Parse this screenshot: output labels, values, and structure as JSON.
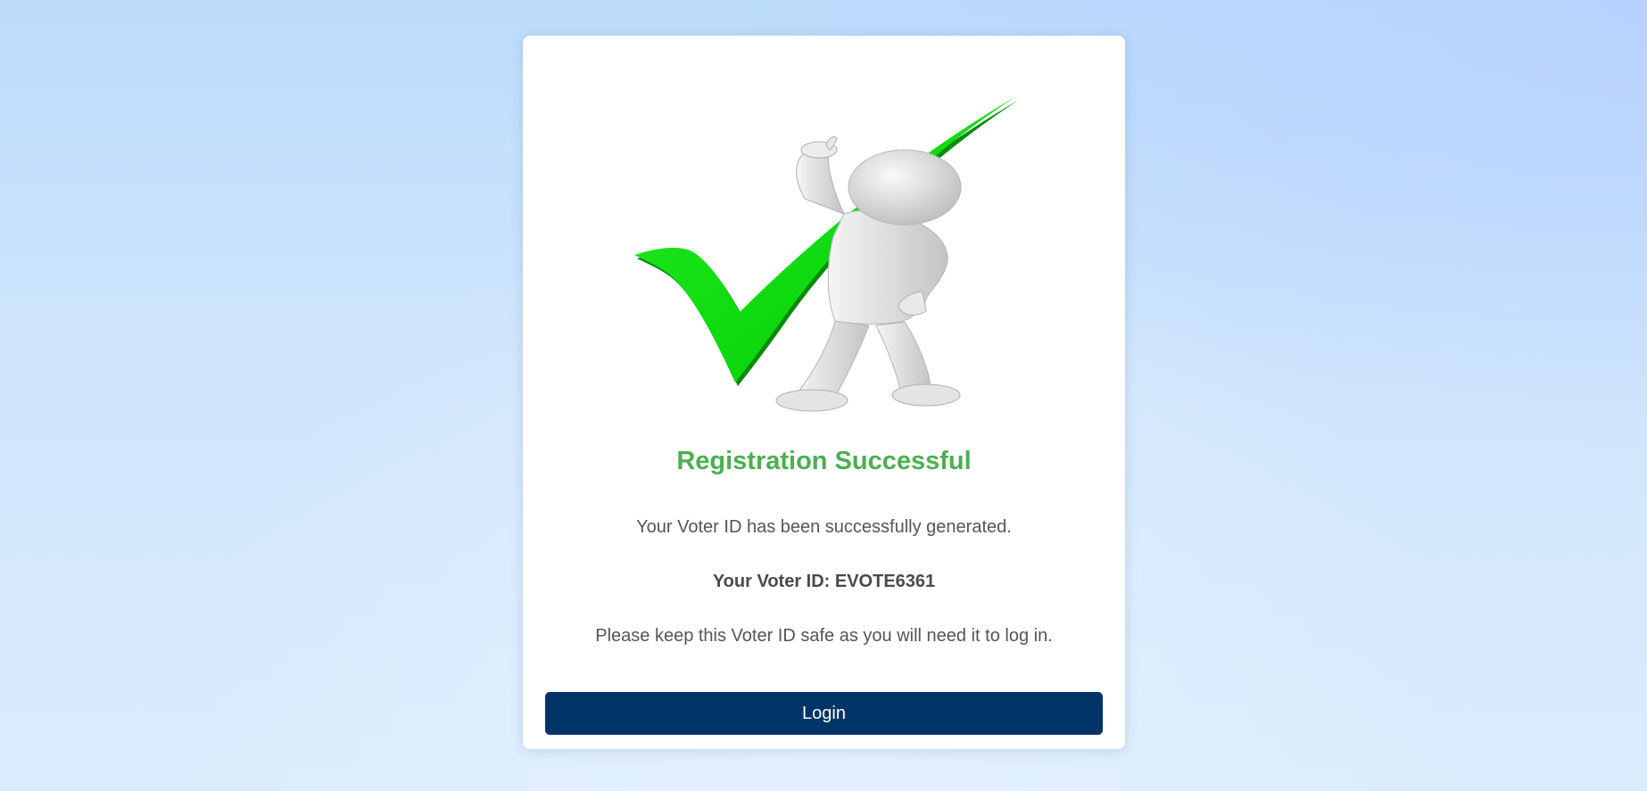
{
  "illustration": {
    "icon": "checkmark-figure-icon",
    "check_color": "#00dd00",
    "figure_color": "#e6e6e6"
  },
  "success": {
    "title": "Registration Successful",
    "message": "Your Voter ID has been successfully generated.",
    "voter_id_text": "Your Voter ID: EVOTE6361",
    "note": "Please keep this Voter ID safe as you will need it to log in.",
    "login_label": "Login"
  },
  "colors": {
    "title": "#4caf50",
    "button": "#003366"
  }
}
